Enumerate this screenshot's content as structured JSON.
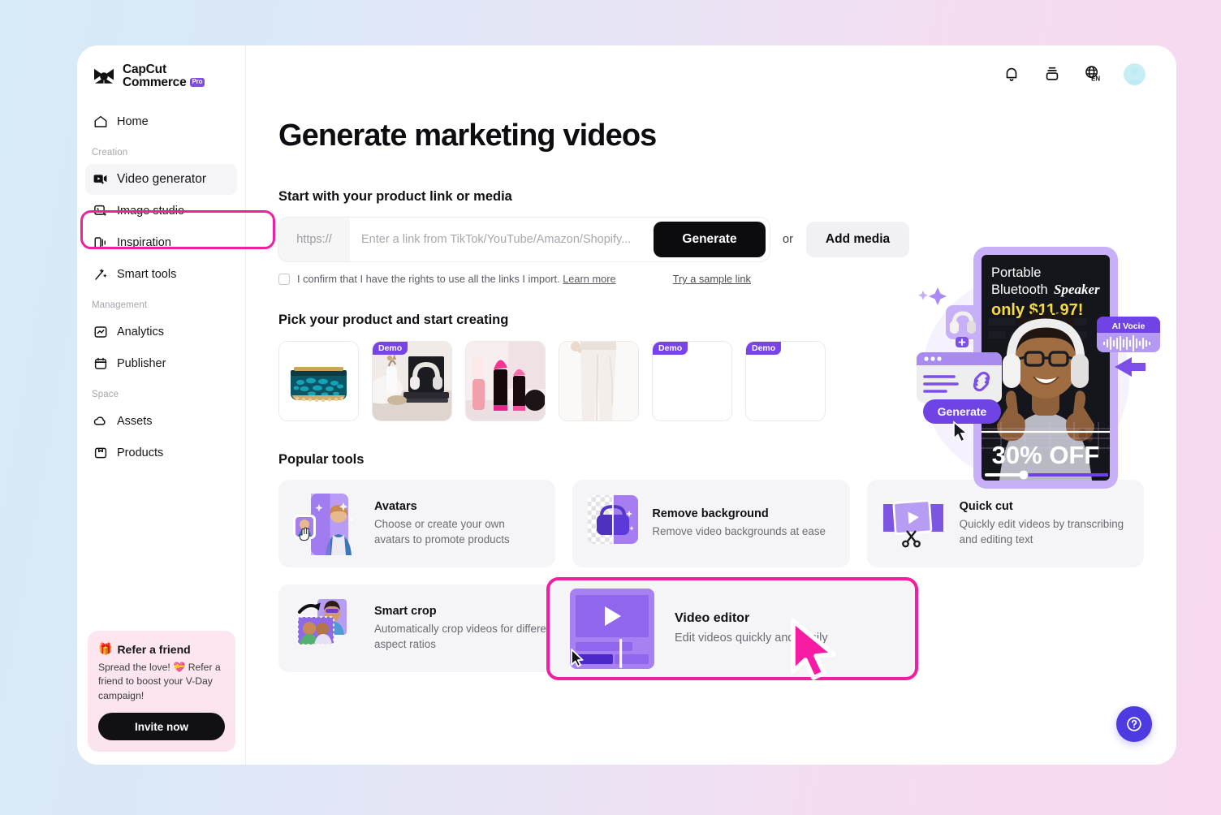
{
  "brand": {
    "line1": "CapCut",
    "line2": "Commerce",
    "badge": "Pro"
  },
  "sidebar": {
    "home": {
      "label": "Home",
      "icon": "home-icon"
    },
    "groups": [
      {
        "label": "Creation",
        "items": [
          {
            "label": "Video generator",
            "icon": "video-generator-icon",
            "active": true,
            "highlighted": true
          },
          {
            "label": "Image studio",
            "icon": "image-studio-icon",
            "active": false
          },
          {
            "label": "Inspiration",
            "icon": "inspiration-icon",
            "active": false
          },
          {
            "label": "Smart tools",
            "icon": "smart-tools-icon",
            "active": false
          }
        ]
      },
      {
        "label": "Management",
        "items": [
          {
            "label": "Analytics",
            "icon": "analytics-icon",
            "active": false
          },
          {
            "label": "Publisher",
            "icon": "publisher-icon",
            "active": false
          }
        ]
      },
      {
        "label": "Space",
        "items": [
          {
            "label": "Assets",
            "icon": "assets-cloud-icon",
            "active": false
          },
          {
            "label": "Products",
            "icon": "products-icon",
            "active": false
          }
        ]
      }
    ],
    "refer": {
      "title": "Refer a friend",
      "emoji": "🎁",
      "body": "Spread the love! 💝 Refer a friend to boost your V-Day campaign!",
      "button": "Invite now"
    }
  },
  "topbar": {
    "notification_icon": "bell-icon",
    "layers_icon": "stack-icon",
    "language_icon": "globe-icon",
    "language_label": "EN",
    "avatar": "user-avatar"
  },
  "main": {
    "title": "Generate marketing videos",
    "link_section": {
      "heading": "Start with your product link or media",
      "https_prefix": "https://",
      "input_value": "",
      "input_placeholder": "Enter a link from TikTok/YouTube/Amazon/Shopify...",
      "generate_label": "Generate",
      "or_label": "or",
      "add_media_label": "Add media",
      "confirm_text": "I confirm that I have the rights to use all the links I import.",
      "learn_more": "Learn more",
      "sample_link": "Try a sample link",
      "confirm_checked": false
    },
    "products_section": {
      "heading": "Pick your product and start creating",
      "demo_tag": "Demo",
      "items": [
        {
          "name": "sequin-clutch-bag",
          "demo": false,
          "empty": false
        },
        {
          "name": "headphones-desk",
          "demo": true,
          "empty": false
        },
        {
          "name": "lipstick-set",
          "demo": false,
          "empty": false
        },
        {
          "name": "white-pants",
          "demo": false,
          "empty": false
        },
        {
          "name": "empty-demo-1",
          "demo": true,
          "empty": true
        },
        {
          "name": "empty-demo-2",
          "demo": true,
          "empty": true
        }
      ]
    },
    "tools_section": {
      "heading": "Popular tools",
      "tools": [
        {
          "name": "Avatars",
          "desc": "Choose or create your own avatars to promote products",
          "icon": "avatars-thumb",
          "highlighted": false
        },
        {
          "name": "Remove background",
          "desc": "Remove video backgrounds at ease",
          "icon": "remove-bg-thumb",
          "highlighted": false
        },
        {
          "name": "Quick cut",
          "desc": "Quickly edit videos by transcribing and editing text",
          "icon": "quick-cut-thumb",
          "highlighted": false
        },
        {
          "name": "Smart crop",
          "desc": "Automatically crop videos for different aspect ratios",
          "icon": "smart-crop-thumb",
          "highlighted": false
        },
        {
          "name": "Video editor",
          "desc": "Edit videos quickly and easily",
          "icon": "video-editor-thumb",
          "highlighted": true
        }
      ]
    }
  },
  "hero": {
    "headline_line1": "Portable",
    "headline_line2a": "Bluetooth",
    "headline_line2b": "Speaker",
    "price_line": "only $11.97!",
    "discount": "30% OFF",
    "ai_voice_label": "AI Vocie",
    "generate_label": "Generate"
  },
  "help": {
    "label": "?",
    "icon": "question-mark-icon"
  },
  "colors": {
    "accent_magenta": "#f01f9f",
    "purple": "#7c4ddf",
    "deep_purple": "#4d3ae0",
    "black": "#0c0c0f",
    "panel_gray": "#f5f5f7"
  }
}
